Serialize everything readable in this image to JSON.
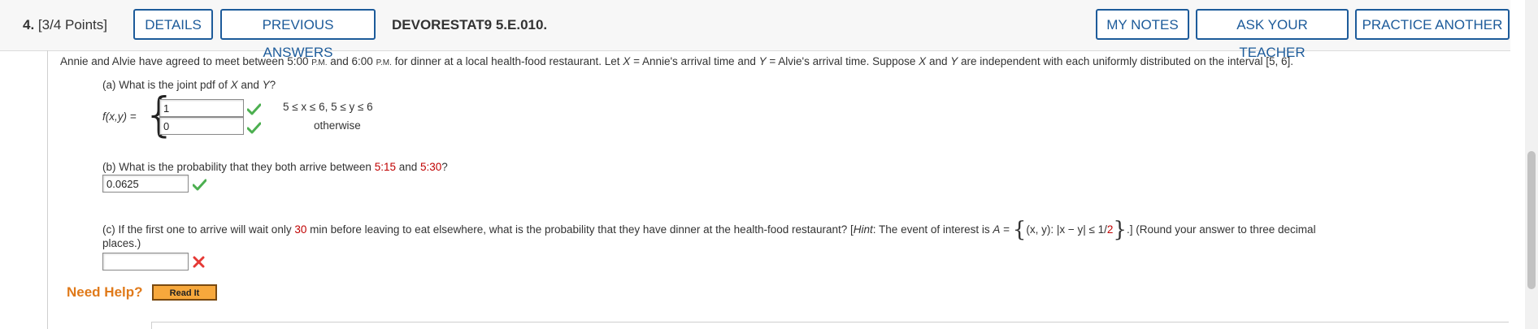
{
  "header": {
    "question_number": "4.",
    "points": "[3/4 Points]",
    "details_label": "DETAILS",
    "previous_answers_label": "PREVIOUS ANSWERS",
    "question_id": "DEVORESTAT9 5.E.010.",
    "my_notes_label": "MY NOTES",
    "ask_teacher_label": "ASK YOUR TEACHER",
    "practice_another_label": "PRACTICE ANOTHER"
  },
  "problem": {
    "intro_1": "Annie and Alvie have agreed to meet between 5:00 ",
    "pm_1": "P.M.",
    "intro_2": " and 6:00 ",
    "pm_2": "P.M.",
    "intro_3": " for dinner at a local health-food restaurant. Let ",
    "var_x": "X",
    "intro_4": " = Annie's arrival time and ",
    "var_y": "Y",
    "intro_5": " = Alvie's arrival time. Suppose ",
    "intro_6": " and ",
    "intro_7": " are independent with each uniformly distributed on the interval [5, 6]."
  },
  "part_a": {
    "question_1": "(a) What is the joint pdf of ",
    "question_2": " and ",
    "question_3": "?",
    "function_label": "f(x,y) =",
    "answer_1": "1",
    "answer_2": "0",
    "condition_1": "5 ≤ x ≤ 6, 5 ≤ y ≤ 6",
    "condition_2": "otherwise"
  },
  "part_b": {
    "question_1": "(b) What is the probability that they both arrive between ",
    "time_1": "5:15",
    "question_2": " and ",
    "time_2": "5:30",
    "question_3": "?",
    "answer": "0.0625"
  },
  "part_c": {
    "question_1": "(c) If the first one to arrive will wait only ",
    "minutes": "30",
    "question_2": " min before leaving to eat elsewhere, what is the probability that they have dinner at the health-food restaurant? [",
    "hint": "Hint",
    "question_3": ": The event of interest is ",
    "var_a": "A",
    "question_4": " = ",
    "set_1": "(x, y): |x − y| ≤ 1/",
    "set_red": "2",
    "question_5": ".] (Round your answer to three decimal",
    "question_6": "places.)",
    "answer": ""
  },
  "help": {
    "need_help": "Need Help?",
    "read_it": "Read It"
  },
  "icons": {
    "correct": "checkmark-icon",
    "incorrect": "x-mark-icon"
  },
  "colors": {
    "accent": "#1d5b9a",
    "correct": "#4caf50",
    "incorrect": "#e53935",
    "highlight": "#c00000",
    "need_help": "#e07a1a"
  }
}
